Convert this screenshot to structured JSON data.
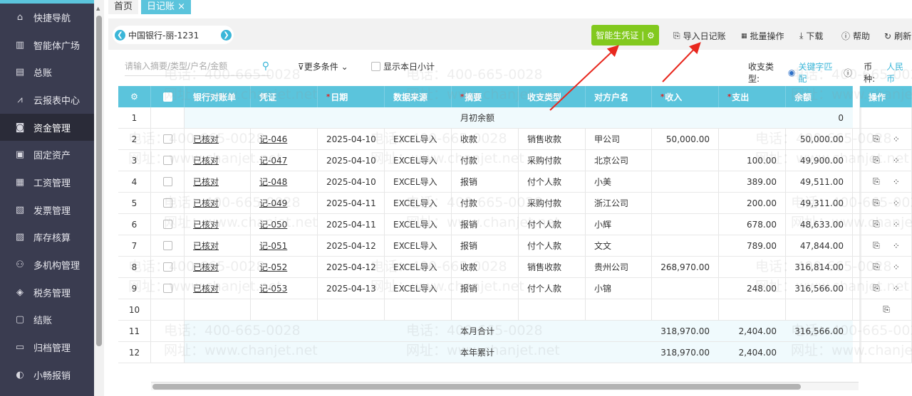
{
  "sidebar": {
    "items": [
      {
        "label": "快捷导航",
        "icon": "home-icon"
      },
      {
        "label": "智能体广场",
        "icon": "building-icon"
      },
      {
        "label": "总账",
        "icon": "ledger-icon"
      },
      {
        "label": "云报表中心",
        "icon": "chart-icon"
      },
      {
        "label": "资金管理",
        "icon": "wallet-icon",
        "active": true
      },
      {
        "label": "固定资产",
        "icon": "asset-icon"
      },
      {
        "label": "工资管理",
        "icon": "salary-icon"
      },
      {
        "label": "发票管理",
        "icon": "invoice-icon"
      },
      {
        "label": "库存核算",
        "icon": "inventory-icon"
      },
      {
        "label": "多机构管理",
        "icon": "org-icon"
      },
      {
        "label": "税务管理",
        "icon": "tax-icon"
      },
      {
        "label": "结账",
        "icon": "close-books-icon"
      },
      {
        "label": "归档管理",
        "icon": "archive-icon"
      },
      {
        "label": "小畅报销",
        "icon": "reimburse-icon"
      }
    ]
  },
  "tabs": [
    {
      "label": "首页"
    },
    {
      "label": "日记账",
      "closable": true
    }
  ],
  "account": "中国银行-丽-1231",
  "toolbar": {
    "generate": "智能生凭证",
    "import": "导入日记账",
    "batch": "批量操作",
    "download": "下载",
    "help": "帮助",
    "refresh": "刷新"
  },
  "filters": {
    "search_placeholder": "请输入摘要/类型/户名/金额",
    "more": "更多条件",
    "show_daily": "显示本日小计",
    "type_label": "收支类型:",
    "type_value": "关键字匹配",
    "currency_label": "币种:",
    "currency_value": "人民币"
  },
  "table": {
    "headers": [
      "银行对账单",
      "凭证",
      "日期",
      "数据来源",
      "摘要",
      "收支类型",
      "对方户名",
      "收入",
      "支出",
      "余额"
    ],
    "required": [
      false,
      false,
      true,
      false,
      true,
      false,
      false,
      true,
      true,
      false
    ],
    "ops_header": "操作",
    "rows": [
      {
        "n": "1",
        "summary": "月初余额",
        "balance": "0",
        "tint": true
      },
      {
        "n": "2",
        "bank": "已核对",
        "voucher": "记-046",
        "date": "2025-04-10",
        "source": "EXCEL导入",
        "summary": "收款",
        "type": "销售收款",
        "party": "甲公司",
        "income": "50,000.00",
        "expense": "",
        "balance": "50,000.00"
      },
      {
        "n": "3",
        "bank": "已核对",
        "voucher": "记-047",
        "date": "2025-04-10",
        "source": "EXCEL导入",
        "summary": "付款",
        "type": "采购付款",
        "party": "北京公司",
        "income": "",
        "expense": "100.00",
        "balance": "49,900.00"
      },
      {
        "n": "4",
        "bank": "已核对",
        "voucher": "记-048",
        "date": "2025-04-10",
        "source": "EXCEL导入",
        "summary": "报销",
        "type": "付个人款",
        "party": "小美",
        "income": "",
        "expense": "389.00",
        "balance": "49,511.00"
      },
      {
        "n": "5",
        "bank": "已核对",
        "voucher": "记-049",
        "date": "2025-04-11",
        "source": "EXCEL导入",
        "summary": "付款",
        "type": "采购付款",
        "party": "浙江公司",
        "income": "",
        "expense": "200.00",
        "balance": "49,311.00"
      },
      {
        "n": "6",
        "bank": "已核对",
        "voucher": "记-050",
        "date": "2025-04-11",
        "source": "EXCEL导入",
        "summary": "报销",
        "type": "付个人款",
        "party": "小辉",
        "income": "",
        "expense": "678.00",
        "balance": "48,633.00"
      },
      {
        "n": "7",
        "bank": "已核对",
        "voucher": "记-051",
        "date": "2025-04-12",
        "source": "EXCEL导入",
        "summary": "报销",
        "type": "付个人款",
        "party": "文文",
        "income": "",
        "expense": "789.00",
        "balance": "47,844.00"
      },
      {
        "n": "8",
        "bank": "已核对",
        "voucher": "记-052",
        "date": "2025-04-12",
        "source": "EXCEL导入",
        "summary": "收款",
        "type": "销售收款",
        "party": "贵州公司",
        "income": "268,970.00",
        "expense": "",
        "balance": "316,814.00"
      },
      {
        "n": "9",
        "bank": "已核对",
        "voucher": "记-053",
        "date": "2025-04-13",
        "source": "EXCEL导入",
        "summary": "报销",
        "type": "付个人款",
        "party": "小锦",
        "income": "",
        "expense": "248.00",
        "balance": "316,566.00"
      },
      {
        "n": "10",
        "empty": true
      },
      {
        "n": "11",
        "summary": "本月合计",
        "income": "318,970.00",
        "expense": "2,404.00",
        "balance": "316,566.00",
        "tint": true
      },
      {
        "n": "12",
        "summary": "本年累计",
        "income": "318,970.00",
        "expense": "2,404.00",
        "tint": true
      }
    ]
  },
  "watermark": {
    "phone": "电话：400-665-0028",
    "site": "网址：www.chanjet.net"
  },
  "colors": {
    "accent": "#5bc4dc",
    "sidebar": "#3a3c50",
    "generate_button": "#82c91e",
    "arrow": "#e8281e"
  }
}
